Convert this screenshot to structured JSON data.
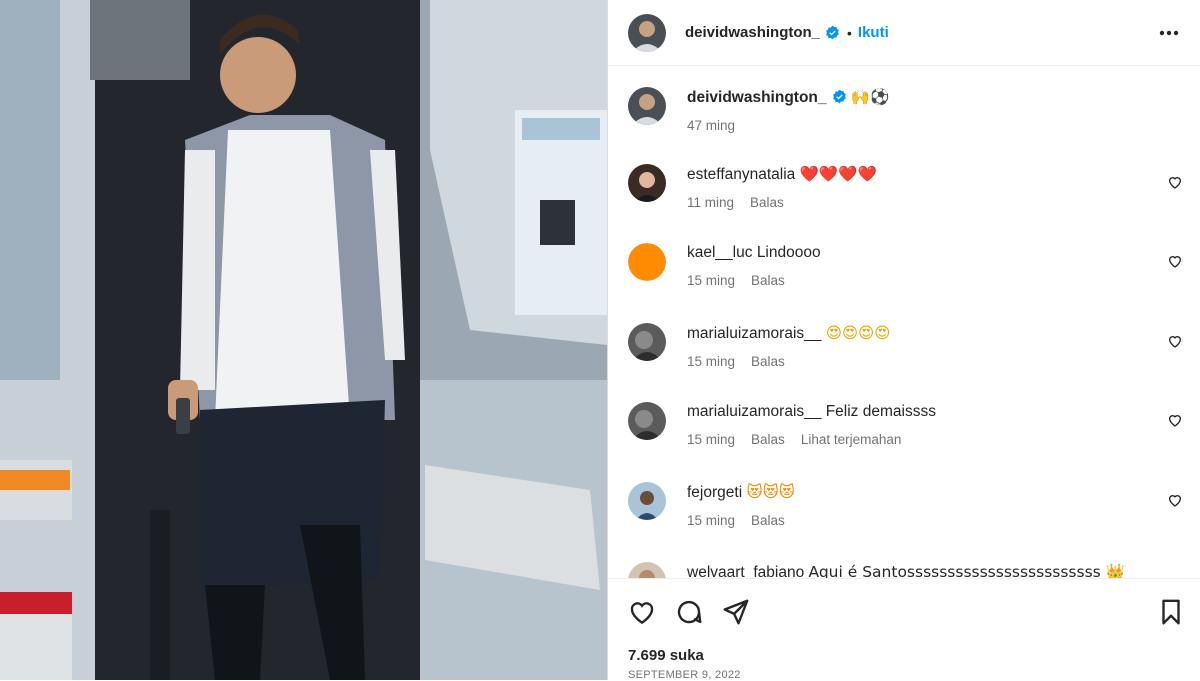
{
  "post": {
    "username": "deividwashington_",
    "follow_label": "Ikuti",
    "caption_emoji": "🙌⚽",
    "caption_time": "47 ming",
    "likes": "7.699 suka",
    "date": "SEPTEMBER 9, 2022"
  },
  "comments": [
    {
      "user": "esteffanynatalia",
      "text": "❤️❤️❤️❤️",
      "time": "11 ming",
      "reply": "Balas",
      "translate": ""
    },
    {
      "user": "kael__luc",
      "text": "Lindoooo",
      "time": "15 ming",
      "reply": "Balas",
      "translate": ""
    },
    {
      "user": "marialuizamorais__",
      "text": "😍😍😍😍",
      "time": "15 ming",
      "reply": "Balas",
      "translate": ""
    },
    {
      "user": "marialuizamorais__",
      "text": "Feliz demaissss",
      "time": "15 ming",
      "reply": "Balas",
      "translate": "Lihat terjemahan"
    },
    {
      "user": "fejorgeti",
      "text": "😻😻😻",
      "time": "15 ming",
      "reply": "Balas",
      "translate": ""
    },
    {
      "user": "welvaart_fabiano",
      "text": "Aqui é Santossssssssssssssssssssssss 👑",
      "time": "",
      "reply": "",
      "translate": ""
    }
  ],
  "icons": {
    "more": "more-horizontal-icon",
    "like": "heart-icon",
    "comment": "comment-icon",
    "share": "send-icon",
    "save": "bookmark-icon",
    "verified": "verified-badge-icon"
  },
  "colors": {
    "accent": "#0095f6",
    "verified": "#0095f6",
    "secondary_text": "#737373",
    "kael_avatar": "#ff8c00"
  }
}
